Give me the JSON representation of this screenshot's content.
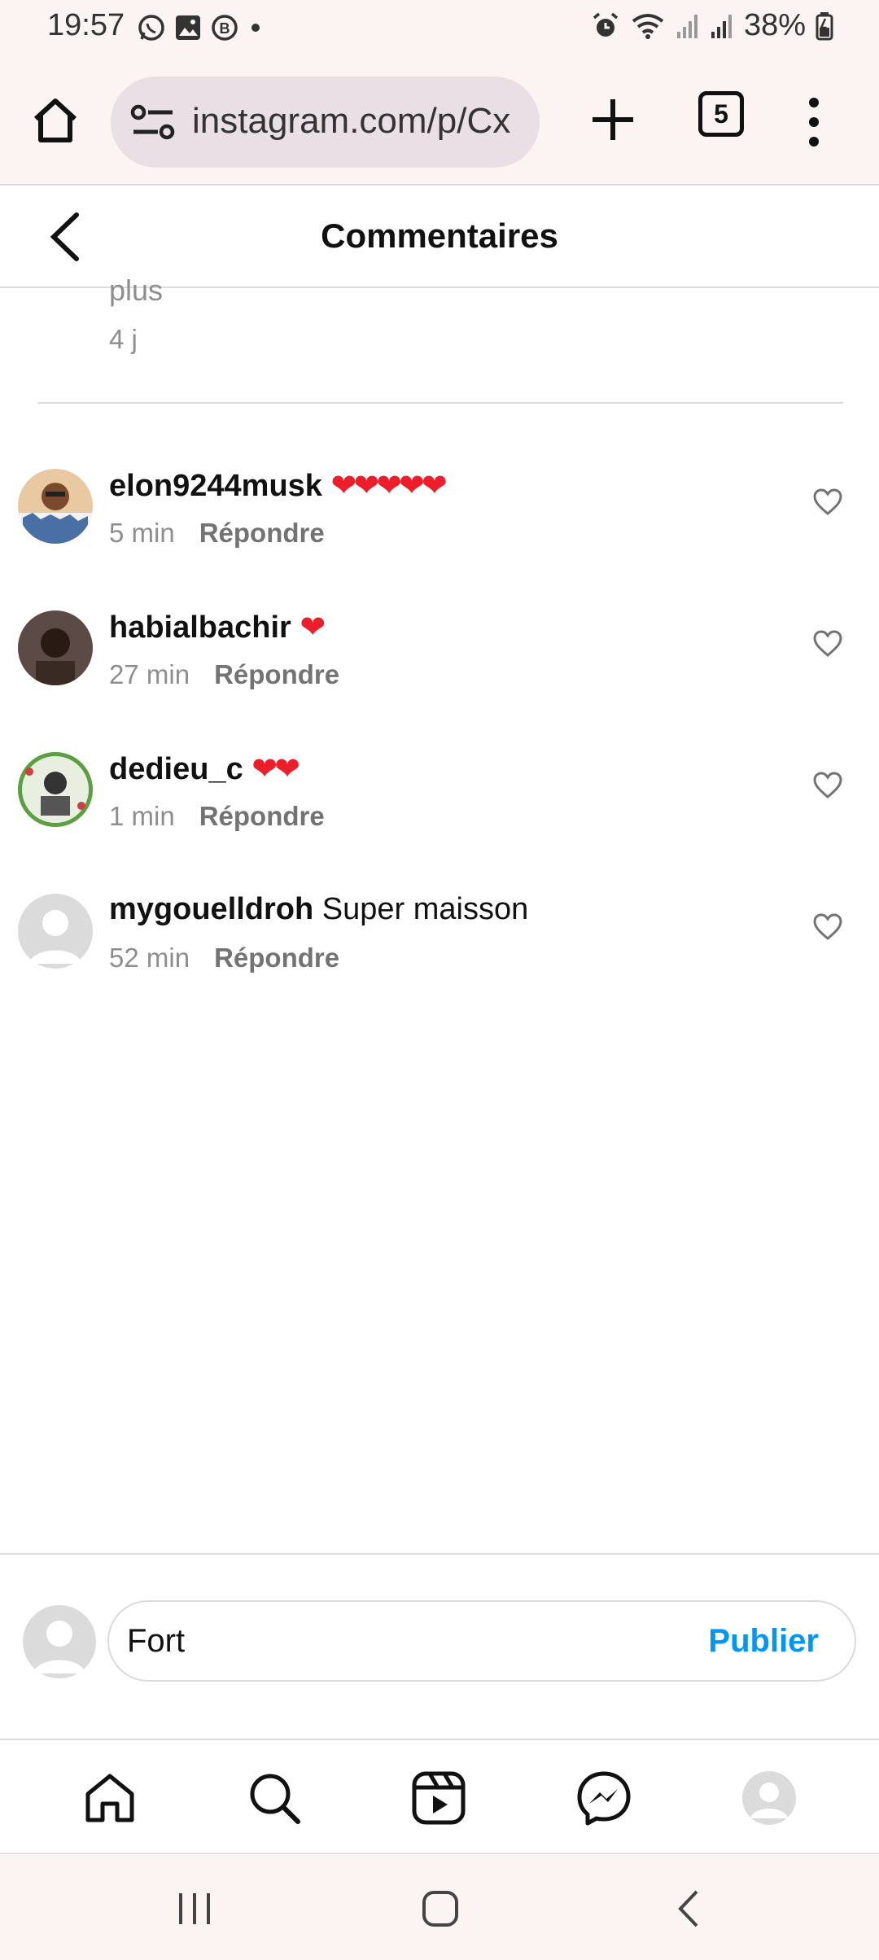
{
  "status_bar": {
    "time": "19:57",
    "battery": "38%"
  },
  "browser": {
    "url": "instagram.com/p/Cx",
    "tab_count": "5"
  },
  "header": {
    "title": "Commentaires"
  },
  "previous_comment": {
    "text_tail": "plus",
    "time": "4 j"
  },
  "comments": [
    {
      "username": "elon9244musk",
      "text": "",
      "hearts": "❤❤❤❤❤",
      "time": "5 min",
      "reply": "Répondre"
    },
    {
      "username": "habialbachir",
      "text": "",
      "hearts": "❤",
      "time": "27 min",
      "reply": "Répondre"
    },
    {
      "username": "dedieu_c",
      "text": "",
      "hearts": "❤❤",
      "time": "1 min",
      "reply": "Répondre"
    },
    {
      "username": "mygouelldroh",
      "text": "Super maisson",
      "hearts": "",
      "time": "52 min",
      "reply": "Répondre"
    }
  ],
  "composer": {
    "value": "Fort",
    "publish_label": "Publier"
  },
  "colors": {
    "accent": "#0095f6",
    "heart": "#ee1d2a",
    "muted": "#8e8e8e"
  }
}
